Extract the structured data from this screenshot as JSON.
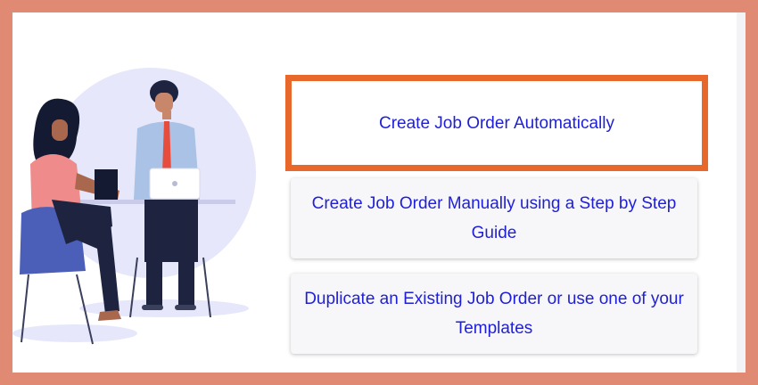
{
  "options": {
    "auto": {
      "label": "Create Job Order Automatically"
    },
    "manual": {
      "label": "Create Job Order Manually using a Step by Step Guide"
    },
    "duplicate": {
      "label": "Duplicate an Existing Job Order or use one of your Templates"
    }
  },
  "colors": {
    "outer_border": "#e08a74",
    "highlight_border": "#e8682b",
    "link_text": "#1f1fd6",
    "card_background": "#f7f7f9"
  },
  "icons": [
    "interview-illustration"
  ]
}
